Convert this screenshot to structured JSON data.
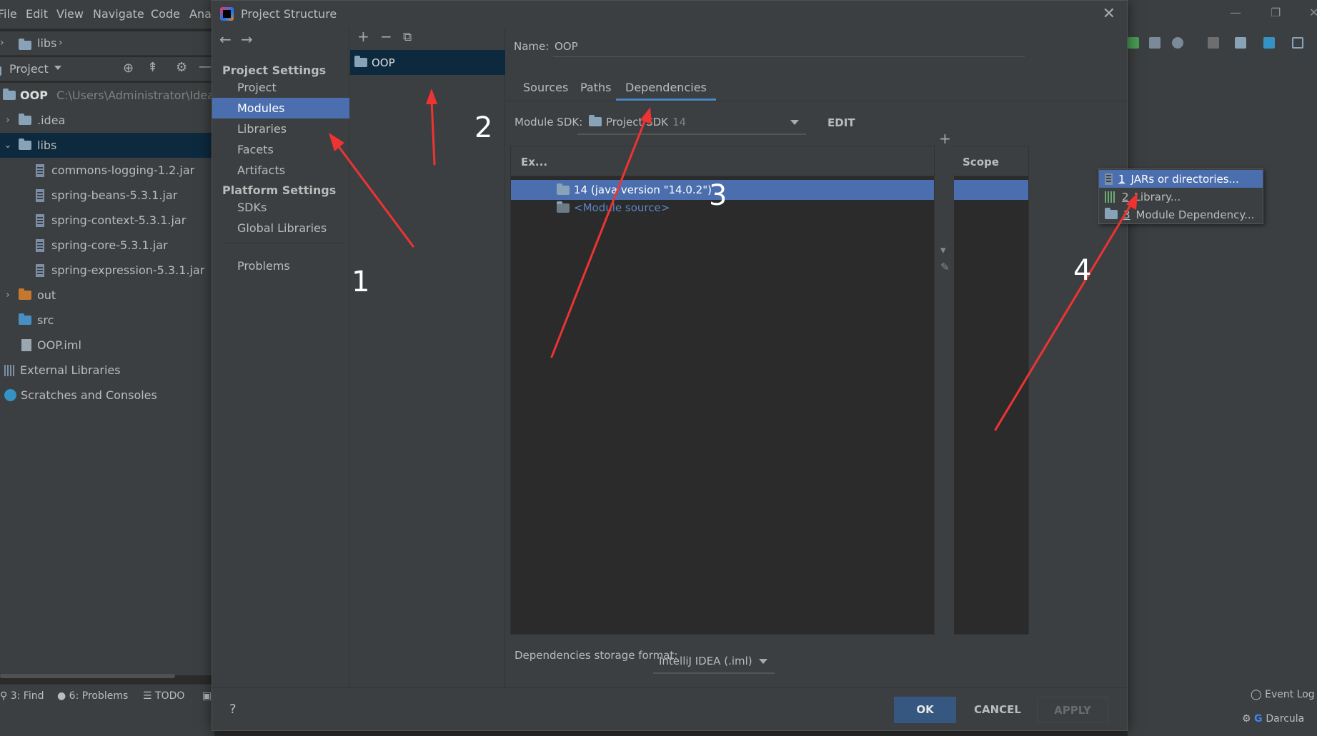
{
  "menubar": {
    "items": [
      "File",
      "Edit",
      "View",
      "Navigate",
      "Code",
      "Anal"
    ]
  },
  "navbar": {
    "crumb": "libs"
  },
  "project_panel": {
    "title": "Project",
    "root": "OOP",
    "root_path": "C:\\Users\\Administrator\\IdeaPro",
    "items": [
      {
        "label": ".idea"
      },
      {
        "label": "libs"
      },
      {
        "label": "commons-logging-1.2.jar"
      },
      {
        "label": "spring-beans-5.3.1.jar"
      },
      {
        "label": "spring-context-5.3.1.jar"
      },
      {
        "label": "spring-core-5.3.1.jar"
      },
      {
        "label": "spring-expression-5.3.1.jar"
      },
      {
        "label": "out"
      },
      {
        "label": "src"
      },
      {
        "label": "OOP.iml"
      },
      {
        "label": "External Libraries"
      },
      {
        "label": "Scratches and Consoles"
      }
    ]
  },
  "bottom_tools": {
    "find": "3: Find",
    "problems": "6: Problems",
    "todo": "TODO",
    "event_log": "Event Log",
    "theme": "Darcula"
  },
  "dialog": {
    "title": "Project Structure",
    "project_settings_head": "Project Settings",
    "project_settings": [
      "Project",
      "Modules",
      "Libraries",
      "Facets",
      "Artifacts"
    ],
    "platform_settings_head": "Platform Settings",
    "platform_settings": [
      "SDKs",
      "Global Libraries"
    ],
    "problems": "Problems",
    "module_name": "OOP",
    "name_label": "Name:",
    "name_value": "OOP",
    "tabs": [
      "Sources",
      "Paths",
      "Dependencies"
    ],
    "sdk_label": "Module SDK:",
    "sdk_value": "Project SDK",
    "sdk_version": "14",
    "edit": "EDIT",
    "col_export": "Ex...",
    "col_scope": "Scope",
    "dependencies": [
      {
        "label": "14 (java version \"14.0.2\")"
      },
      {
        "label": "<Module source>"
      }
    ],
    "storage_label": "Dependencies storage format:",
    "storage_value": "IntelliJ IDEA (.iml)",
    "help": "?",
    "ok": "OK",
    "cancel": "CANCEL",
    "apply": "APPLY"
  },
  "popup": {
    "items": [
      {
        "num": "1",
        "label": "JARs or directories..."
      },
      {
        "num": "2",
        "label": "Library..."
      },
      {
        "num": "3",
        "label": "Module Dependency..."
      }
    ]
  },
  "annotations": [
    "1",
    "2",
    "3",
    "4"
  ],
  "colors": {
    "accent": "#4b6eaf",
    "selection_dark": "#0d293e",
    "arrow": "#ee3333",
    "ok_button": "#365880"
  }
}
